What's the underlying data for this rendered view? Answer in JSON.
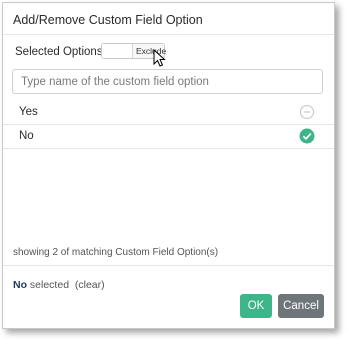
{
  "dialog": {
    "title": "Add/Remove Custom Field Option",
    "selected_options_label": "Selected Options:",
    "toggle_label": "Exclude",
    "search": {
      "value": "",
      "placeholder": "Type name of the custom field option"
    },
    "options": [
      {
        "label": "Yes",
        "selected": false
      },
      {
        "label": "No",
        "selected": true
      }
    ],
    "match_count_text": "showing 2 of matching Custom Field Option(s)",
    "selection": {
      "value": "No",
      "suffix": "selected",
      "clear_label": "(clear)"
    },
    "buttons": {
      "ok": "OK",
      "cancel": "Cancel"
    },
    "colors": {
      "ok": "#3db589",
      "cancel": "#6f7679",
      "check": "#3db589"
    }
  }
}
